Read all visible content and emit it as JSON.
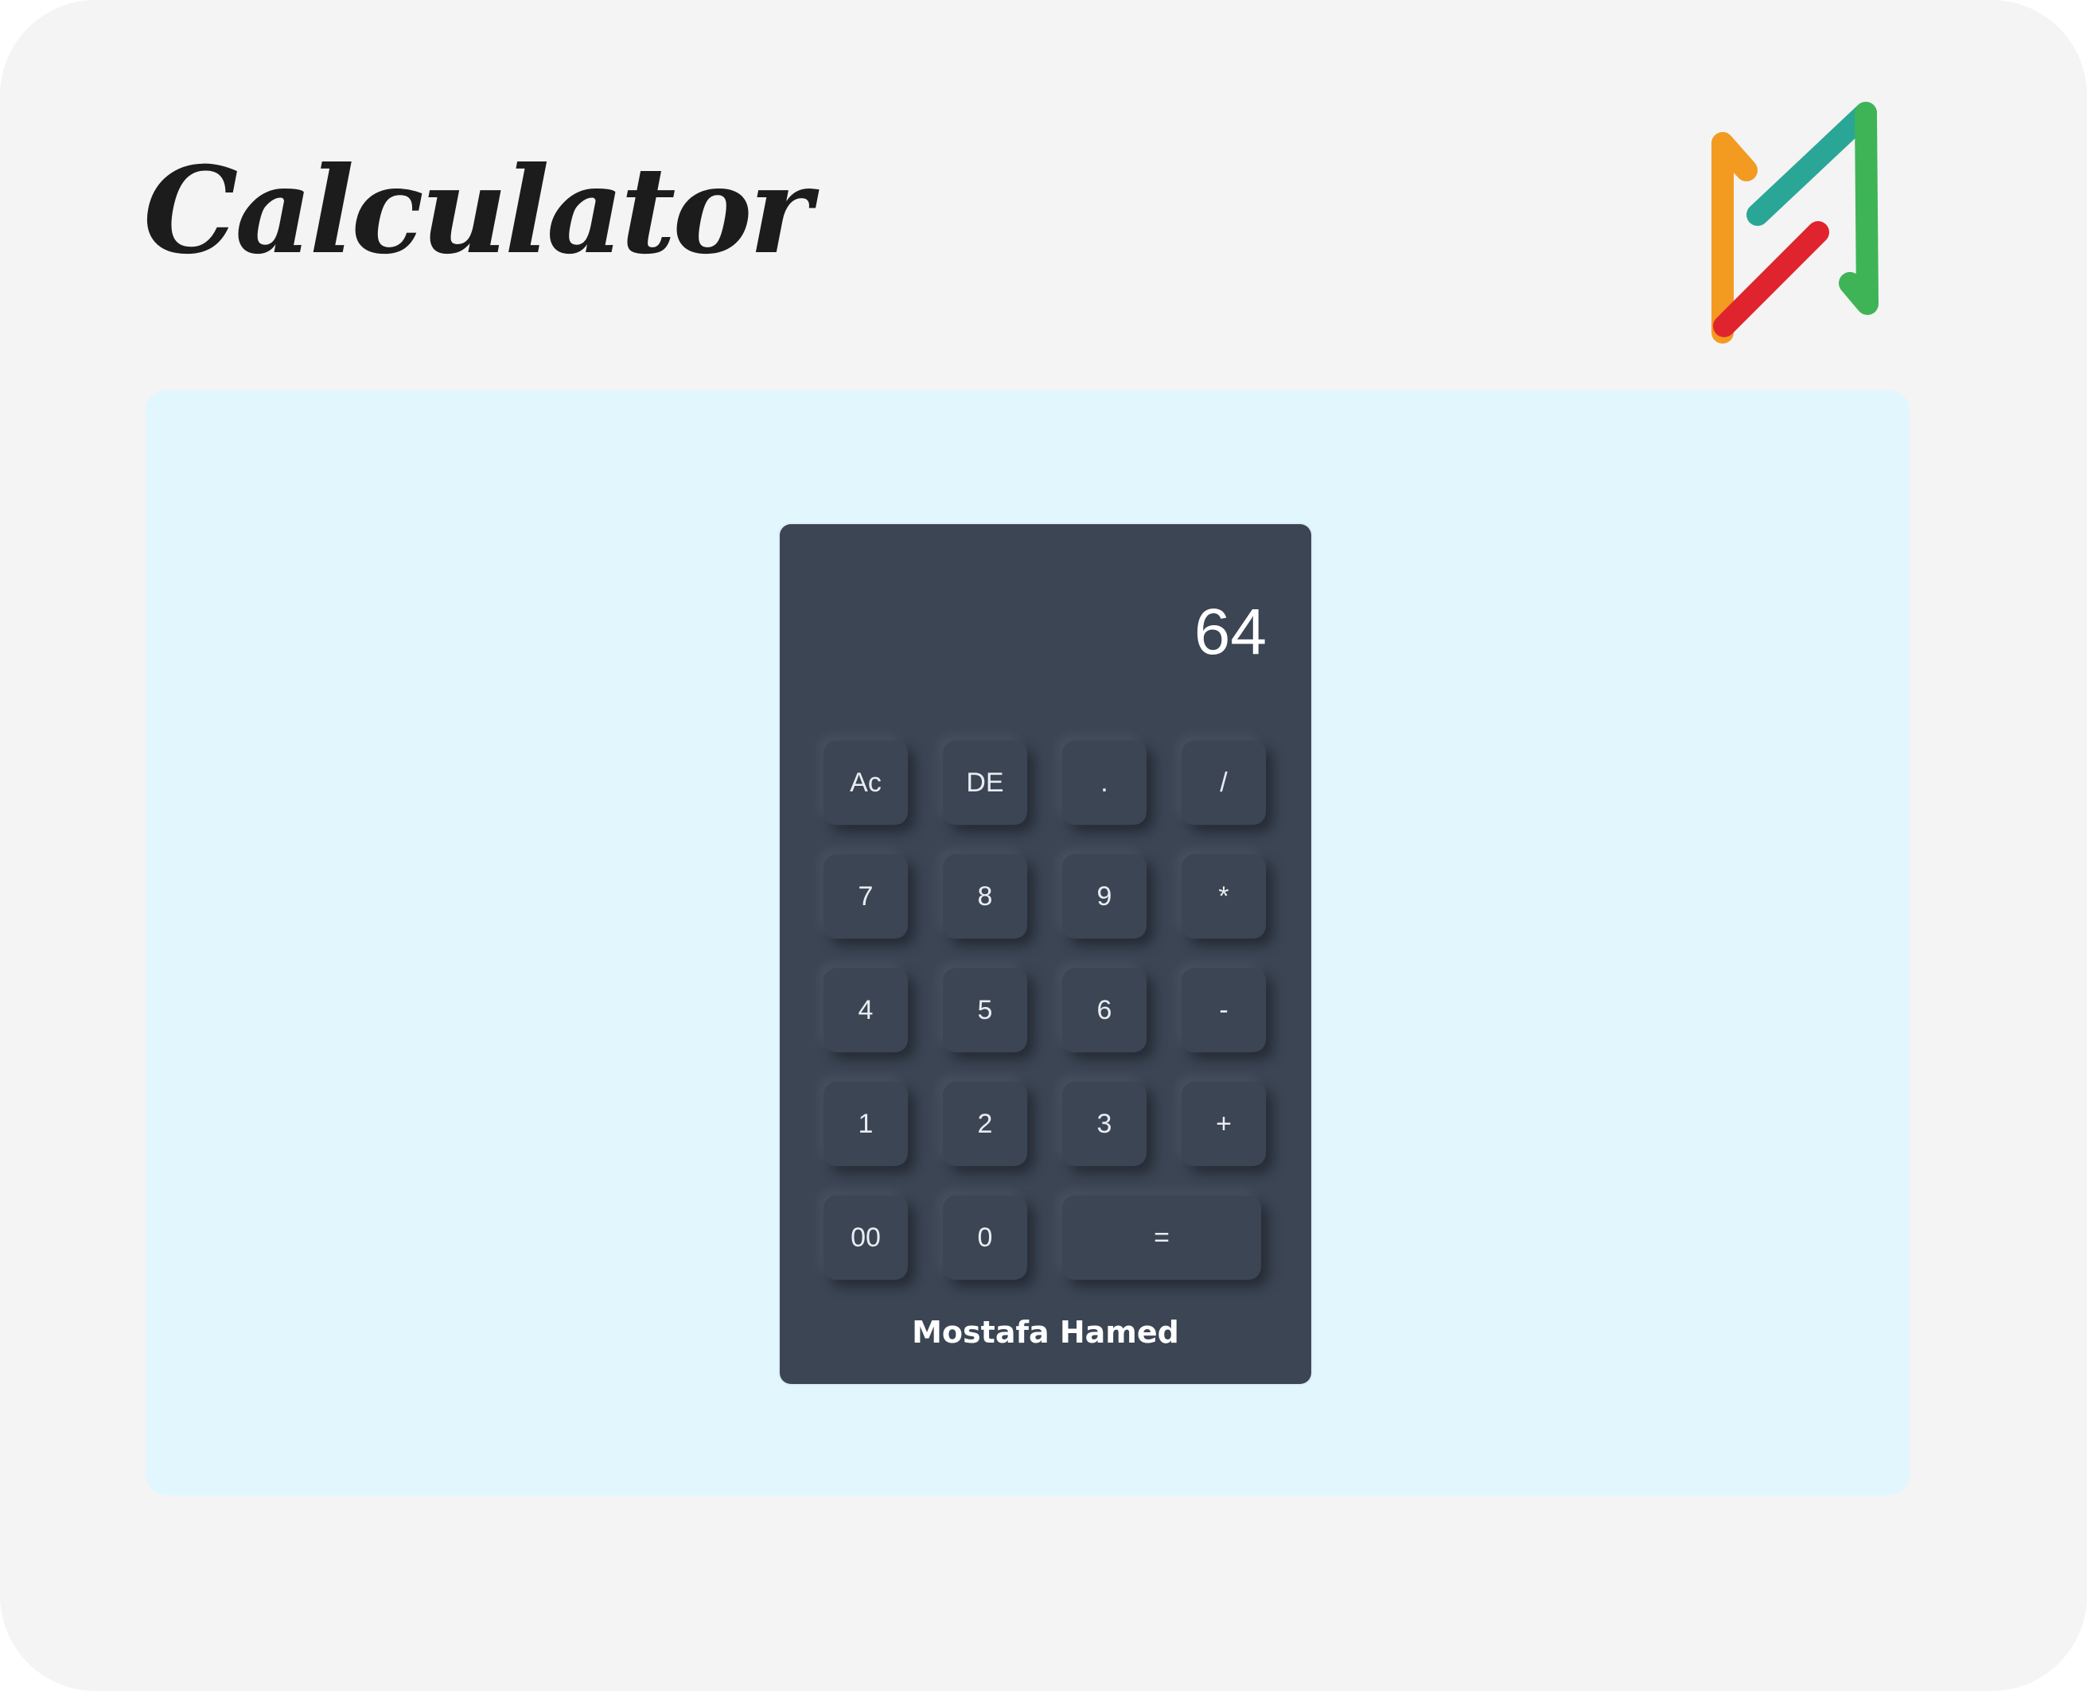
{
  "header": {
    "title": "Calculator",
    "logo_icon": "mh-logo-icon"
  },
  "colors": {
    "page_background": "#f4f4f4",
    "stage_background": "#e2f6fd",
    "calculator_body": "#3b4554",
    "logo_orange": "#f39a21",
    "logo_teal": "#2aa696",
    "logo_red": "#e0242d",
    "logo_green": "#3fb457"
  },
  "calculator": {
    "display_value": "64",
    "keys": [
      [
        "Ac",
        "DE",
        ".",
        "/"
      ],
      [
        "7",
        "8",
        "9",
        "*"
      ],
      [
        "4",
        "5",
        "6",
        "-"
      ],
      [
        "1",
        "2",
        "3",
        "+"
      ],
      [
        "00",
        "0",
        "="
      ]
    ],
    "author": "Mostafa Hamed"
  }
}
